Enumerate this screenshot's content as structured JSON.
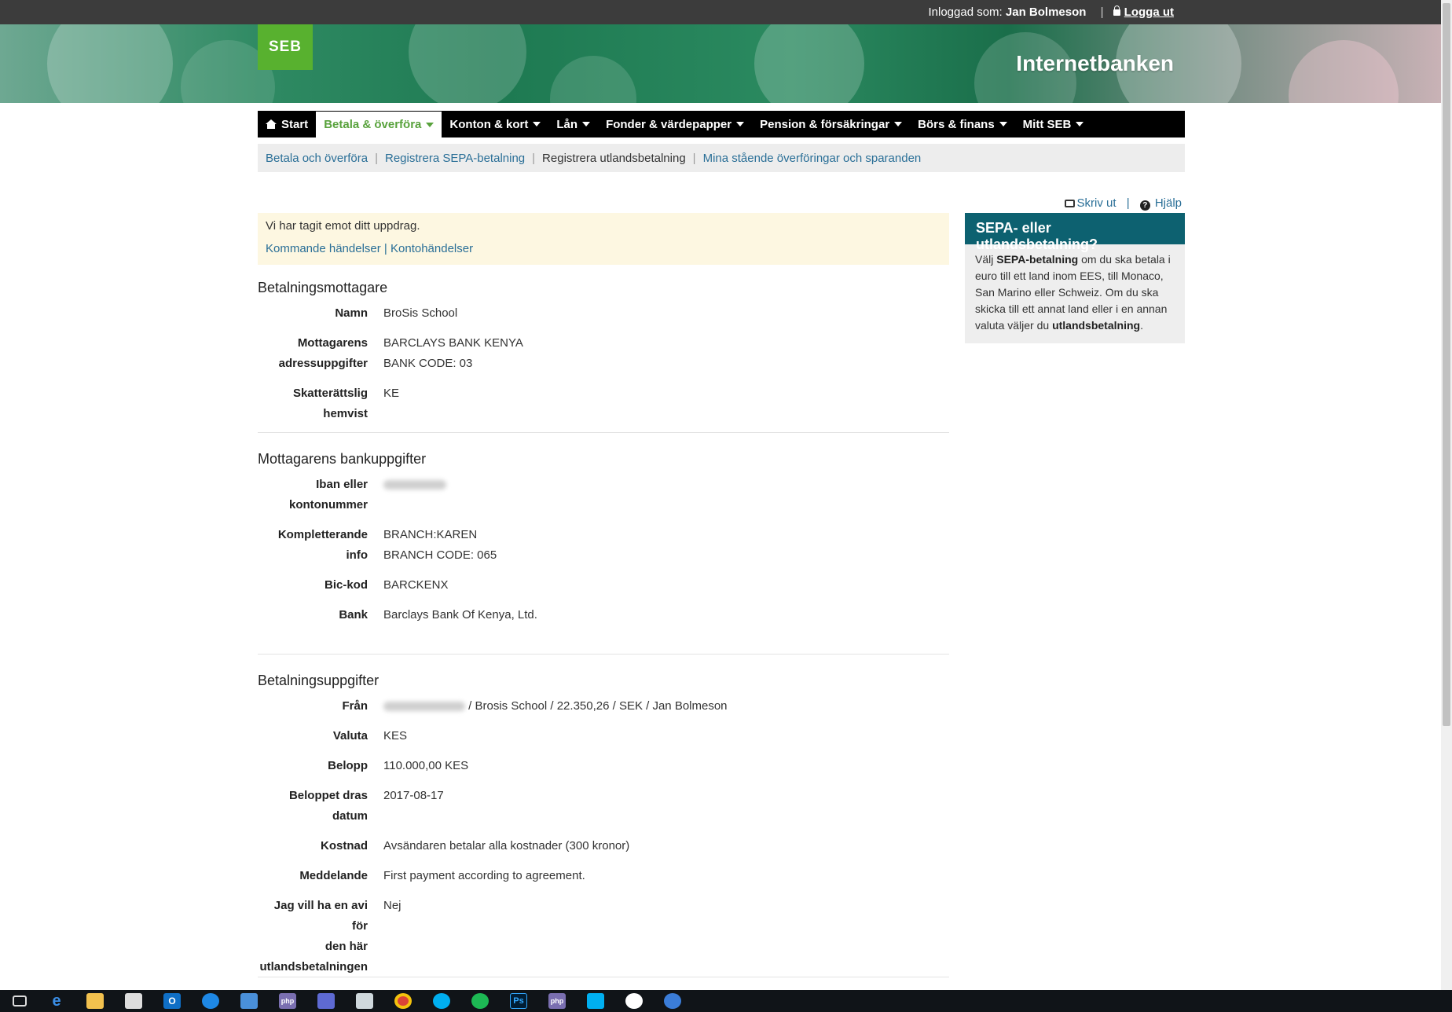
{
  "topbar": {
    "logged_in_label": "Inloggad som:",
    "user_name": "Jan Bolmeson",
    "logout_label": "Logga ut"
  },
  "header": {
    "logo_text": "SEB",
    "title": "Internetbanken"
  },
  "mainnav": {
    "items": [
      {
        "label": "Start"
      },
      {
        "label": "Betala & överföra"
      },
      {
        "label": "Konton & kort"
      },
      {
        "label": "Lån"
      },
      {
        "label": "Fonder & värdepapper"
      },
      {
        "label": "Pension & försäkringar"
      },
      {
        "label": "Börs & finans"
      },
      {
        "label": "Mitt SEB"
      }
    ]
  },
  "subnav": {
    "items": [
      {
        "label": "Betala och överföra"
      },
      {
        "label": "Registrera SEPA-betalning"
      },
      {
        "label": "Registrera utlandsbetalning"
      },
      {
        "label": "Mina stående överföringar och sparanden"
      }
    ]
  },
  "tools": {
    "print_label": "Skriv ut",
    "help_label": "Hjälp"
  },
  "notice": {
    "message": "Vi har tagit emot ditt uppdrag.",
    "link1": "Kommande händelser",
    "link_sep": " | ",
    "link2": "Kontohändelser"
  },
  "recipient": {
    "title": "Betalningsmottagare",
    "name_label": "Namn",
    "name_value": "BroSis School",
    "address_label_1": "Mottagarens",
    "address_label_2": "adressuppgifter",
    "address_line1": "BARCLAYS BANK KENYA",
    "address_line2": "BANK CODE: 03",
    "tax_label": "Skatterättslig hemvist",
    "tax_value": "KE"
  },
  "bank": {
    "title": "Mottagarens bankuppgifter",
    "iban_label_1": "Iban eller",
    "iban_label_2": "kontonummer",
    "extra_label": "Kompletterande info",
    "extra_line1": "BRANCH:KAREN",
    "extra_line2": "BRANCH CODE: 065",
    "bic_label": "Bic-kod",
    "bic_value": "BARCKENX",
    "bank_label": "Bank",
    "bank_value": "Barclays Bank Of Kenya, Ltd."
  },
  "payment": {
    "title": "Betalningsuppgifter",
    "from_label": "Från",
    "from_value": "/ Brosis School / 22.350,26 / SEK / Jan Bolmeson",
    "currency_label": "Valuta",
    "currency_value": "KES",
    "amount_label": "Belopp",
    "amount_value": "110.000,00 KES",
    "date_label": "Beloppet dras datum",
    "date_value": "2017-08-17",
    "cost_label": "Kostnad",
    "cost_value": "Avsändaren betalar alla kostnader (300 kronor)",
    "message_label": "Meddelande",
    "message_value": "First payment according to agreement.",
    "notice_label_1": "Jag vill ha en avi för",
    "notice_label_2": "den här",
    "notice_label_3": "utlandsbetalningen",
    "notice_value": "Nej"
  },
  "sidebox": {
    "title": "SEPA- eller utlandsbetalning?",
    "t1": "Välj ",
    "b1": "SEPA-betalning",
    "t2": " om du ska betala i euro till ett land inom EES, till Monaco, San Marino eller Schweiz. Om du ska skicka till ett annat land eller i en annan valuta väljer du ",
    "b2": "utlandsbetalning",
    "t3": "."
  },
  "taskbar": {
    "icons": [
      "task-view-icon",
      "edge-icon",
      "file-explorer-icon",
      "store-icon",
      "outlook-icon",
      "app-icon",
      "app-icon",
      "php-icon",
      "network-icon",
      "app-icon",
      "chrome-icon",
      "skype-icon",
      "spotify-icon",
      "photoshop-icon",
      "php-icon",
      "skype-icon",
      "slack-icon",
      "chat-icon"
    ],
    "labels": {
      "photoshop": "Ps",
      "outlook": "O",
      "php": "php"
    }
  }
}
